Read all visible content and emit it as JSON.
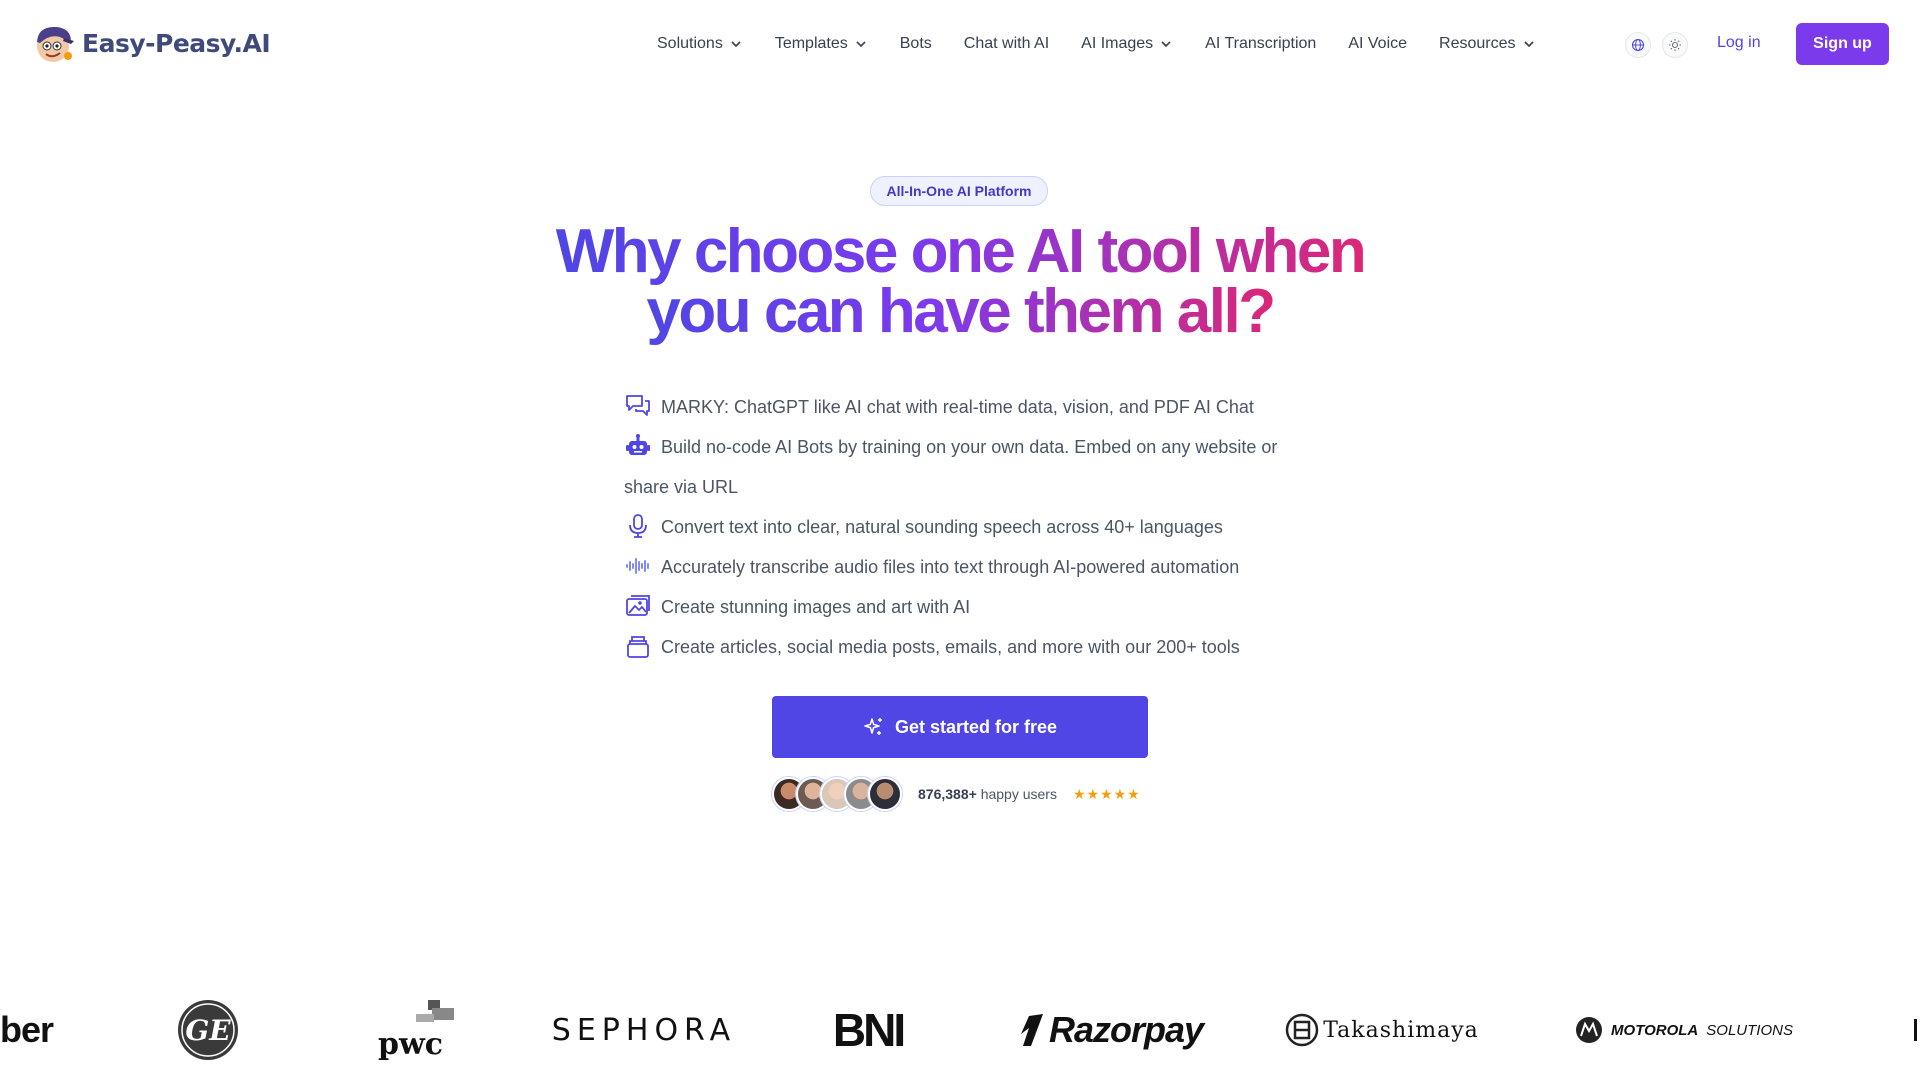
{
  "header": {
    "logo_text": "Easy-Peasy.AI",
    "nav": [
      {
        "label": "Solutions",
        "has_dropdown": true
      },
      {
        "label": "Templates",
        "has_dropdown": true
      },
      {
        "label": "Bots",
        "has_dropdown": false
      },
      {
        "label": "Chat with AI",
        "has_dropdown": false
      },
      {
        "label": "AI Images",
        "has_dropdown": true
      },
      {
        "label": "AI Transcription",
        "has_dropdown": false
      },
      {
        "label": "AI Voice",
        "has_dropdown": false
      },
      {
        "label": "Resources",
        "has_dropdown": true
      }
    ],
    "icons": [
      "globe-icon",
      "sun-icon"
    ],
    "login_label": "Log in",
    "signup_label": "Sign up"
  },
  "hero": {
    "badge": "All-In-One AI Platform",
    "headline_line1": "Why choose one AI tool when",
    "headline_line2": "you can have them all?",
    "features": [
      {
        "icon": "chat-bubbles-icon",
        "text": "MARKY: ChatGPT like AI chat with real-time data, vision, and PDF AI Chat"
      },
      {
        "icon": "robot-icon",
        "text": "Build no-code AI Bots by training on your own data. Embed on any website or share via URL"
      },
      {
        "icon": "microphone-icon",
        "text": "Convert text into clear, natural sounding speech across 40+ languages"
      },
      {
        "icon": "waveform-icon",
        "text": "Accurately transcribe audio files into text through AI-powered automation"
      },
      {
        "icon": "images-icon",
        "text": "Create stunning images and art with AI"
      },
      {
        "icon": "stack-icon",
        "text": "Create articles, social media posts, emails, and more with our 200+ tools"
      }
    ],
    "cta_label": "Get started for free",
    "users_count": "876,388+",
    "users_suffix": "happy users",
    "rating": "★★★★★"
  },
  "brands": {
    "ber": "ber",
    "ge": "GE",
    "pwc": "pwc",
    "sephora": "SEPHORA",
    "bni": "BNI",
    "razorpay": "Razorpay",
    "takashimaya": "Takashimaya",
    "motorola": "MOTOROLA",
    "motorola_suffix": "SOLUTIONS"
  },
  "colors": {
    "accent": "#4f46e5",
    "signup": "#7c3aed",
    "gradient_start": "#4f46e5",
    "gradient_end": "#db2777",
    "star": "#f59e0b"
  }
}
